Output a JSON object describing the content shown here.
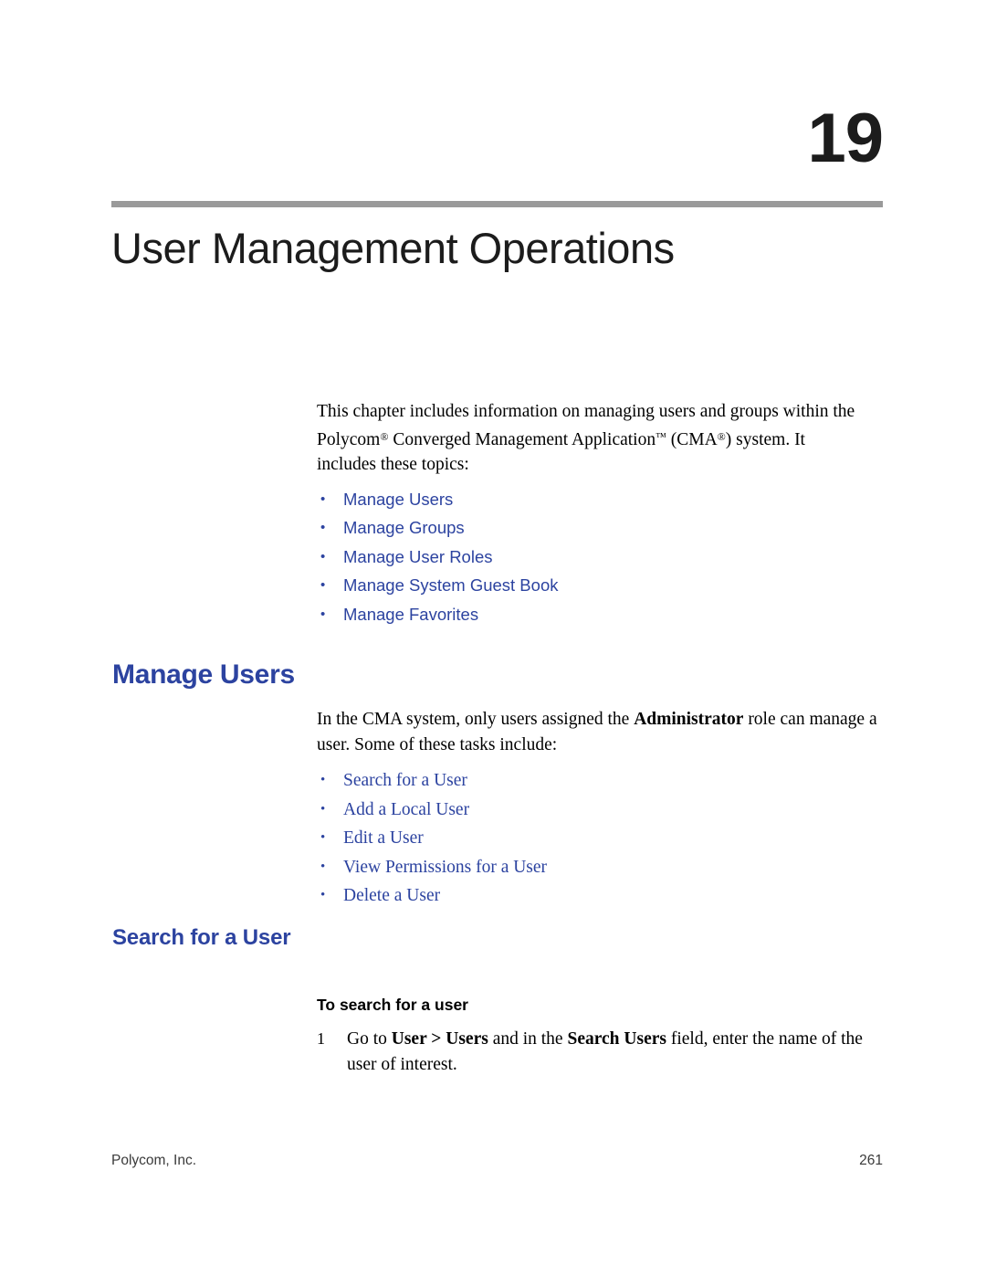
{
  "chapter": {
    "number": "19",
    "title": "User Management Operations"
  },
  "intro": {
    "line1": "This chapter includes information on managing users and groups within the",
    "line2_a": "Polycom",
    "line2_sup1": "®",
    "line2_b": " Converged Management Application",
    "line2_sup2": "™",
    "line2_c": " (CMA",
    "line2_sup3": "®",
    "line2_d": ") system. It",
    "line3": "includes these topics:",
    "topics": [
      "Manage Users",
      "Manage Groups",
      "Manage User Roles",
      "Manage System Guest Book",
      "Manage Favorites"
    ]
  },
  "section_manage_users": {
    "heading": "Manage Users",
    "para_a": "In the CMA system, only users assigned the ",
    "para_bold": "Administrator",
    "para_b": " role can manage a",
    "para_line2": "user. Some of these tasks include:",
    "tasks": [
      "Search for a User",
      "Add a Local User",
      "Edit a User",
      "View Permissions for a User",
      "Delete a User"
    ]
  },
  "section_search": {
    "heading": "Search for a User",
    "procedure_title": "To search for a user",
    "step1": {
      "number": "1",
      "text_a": "Go to ",
      "bold_a": "User > Users",
      "text_b": " and in the ",
      "bold_b": "Search Users",
      "text_c": " field, enter the name of the",
      "text_line2": "user of interest."
    }
  },
  "footer": {
    "left": "Polycom, Inc.",
    "right": "261"
  }
}
